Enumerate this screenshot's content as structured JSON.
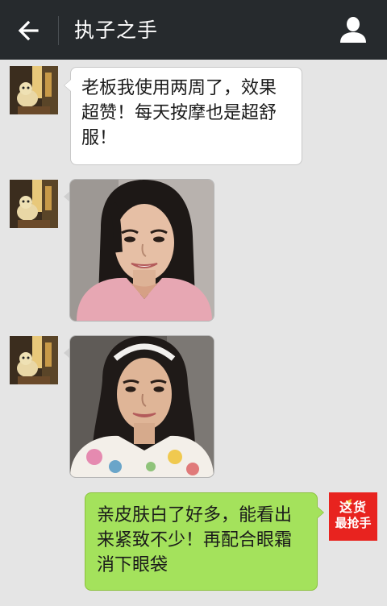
{
  "header": {
    "title": "执子之手",
    "back_icon": "arrow-left-icon",
    "profile_icon": "person-icon",
    "background_color": "#262a2d"
  },
  "chat": {
    "background_color": "#e5e5e5",
    "messages": [
      {
        "sender": "contact",
        "type": "text",
        "text": "老板我使用两周了，效果超赞！每天按摩也是超舒服！"
      },
      {
        "sender": "contact",
        "type": "image",
        "image": "smiling woman in pink top, selfie"
      },
      {
        "sender": "contact",
        "type": "image",
        "image": "smiling woman with white headband and floral top, selfie"
      },
      {
        "sender": "self",
        "type": "text",
        "text": "亲皮肤白了好多，能看出来紧致不少！再配合眼霜消下眼袋"
      }
    ],
    "self_bubble_color": "#a4e25c",
    "contact_bubble_color": "#ffffff"
  },
  "self_avatar": {
    "line1": "这货",
    "line2": "最抢手",
    "background_color": "#e8231f"
  }
}
